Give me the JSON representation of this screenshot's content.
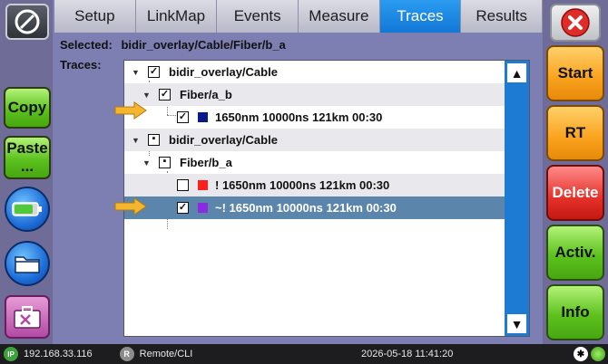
{
  "tabs": [
    {
      "label": "Setup"
    },
    {
      "label": "LinkMap"
    },
    {
      "label": "Events"
    },
    {
      "label": "Measure"
    },
    {
      "label": "Traces"
    },
    {
      "label": "Results"
    }
  ],
  "active_tab": "Traces",
  "left_toolbar": {
    "copy_label": "Copy",
    "paste_label": "Paste\n..."
  },
  "right_toolbar": {
    "start_label": "Start",
    "rt_label": "RT",
    "delete_label": "Delete",
    "activ_label": "Activ.",
    "info_label": "Info"
  },
  "selected": {
    "label": "Selected:",
    "value": "bidir_overlay/Cable/Fiber/b_a"
  },
  "traces_label": "Traces:",
  "tree": {
    "rows": [
      {
        "text": "bidir_overlay/Cable",
        "check": "checked"
      },
      {
        "text": "Fiber/a_b",
        "check": "checked"
      },
      {
        "text": "1650nm 10000ns 121km 00:30",
        "check": "checked",
        "swatch": "#0a1a8c"
      },
      {
        "text": "bidir_overlay/Cable",
        "check": "partial"
      },
      {
        "text": "Fiber/b_a",
        "check": "partial"
      },
      {
        "text": "! 1650nm 10000ns 121km 00:30",
        "check": "unchecked",
        "swatch": "#ff1e1e"
      },
      {
        "text": "~! 1650nm 10000ns 121km 00:30",
        "check": "checked",
        "swatch": "#8a2be2"
      }
    ]
  },
  "status": {
    "ip": "192.168.33.116",
    "ip_badge": "IP",
    "remote_badge": "R",
    "remote": "Remote/CLI",
    "datetime": "2026-05-18  11:41:20"
  }
}
